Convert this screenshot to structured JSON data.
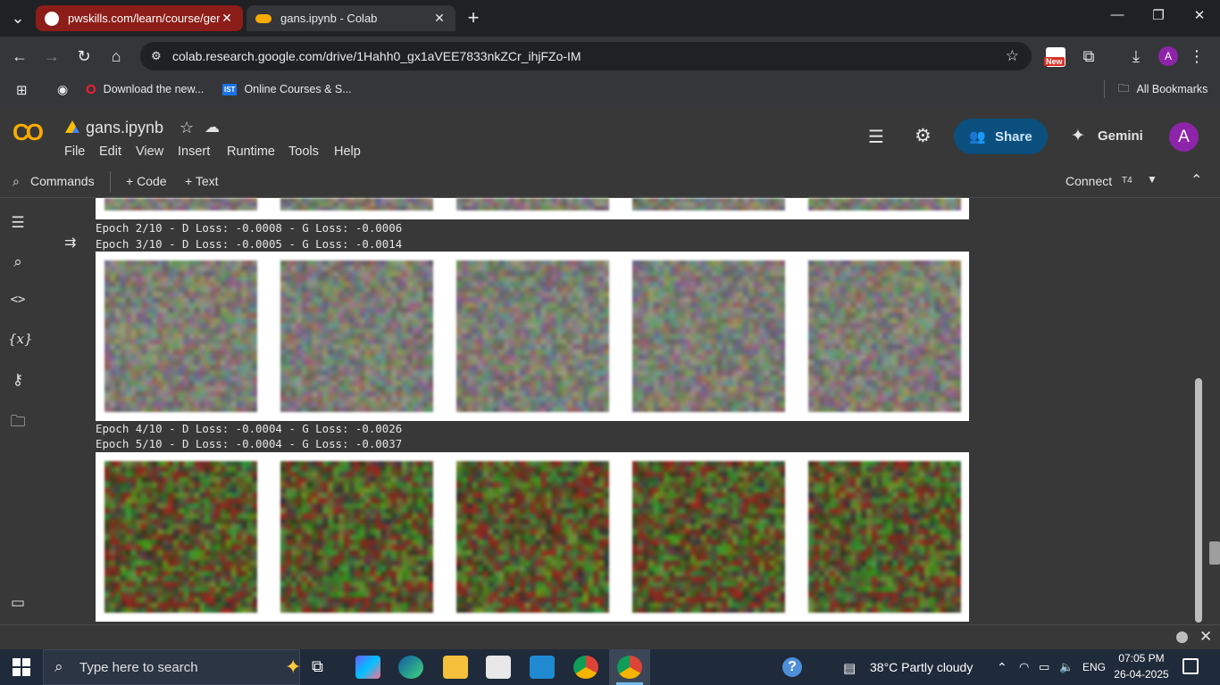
{
  "browser": {
    "tabs": [
      {
        "title": "pwskills.com/learn/course/gena",
        "color": "#8c1d18"
      },
      {
        "title": "gans.ipynb - Colab",
        "active": true
      }
    ],
    "url": "colab.research.google.com/drive/1Hahh0_gx1aVEE7833nkZCr_ihjFZo-IM",
    "ext_badge": "New",
    "profile_initial": "A",
    "bookmarks": [
      "Download the new...",
      "Online Courses & S..."
    ],
    "bookmark_badge": "IST",
    "all_bookmarks": "All Bookmarks"
  },
  "colab": {
    "logo": "CO",
    "notebook_title": "gans.ipynb",
    "menus": [
      "File",
      "Edit",
      "View",
      "Insert",
      "Runtime",
      "Tools",
      "Help"
    ],
    "share_label": "Share",
    "gemini_label": "Gemini",
    "avatar_initial": "A",
    "commands_label": "Commands",
    "code_label": "+ Code",
    "text_label": "+ Text",
    "connect_label": "Connect",
    "runtime_type": "T4"
  },
  "output": {
    "logs": [
      "Epoch 2/10 - D Loss: -0.0008 - G Loss: -0.0006",
      "Epoch 3/10 - D Loss: -0.0005 - G Loss: -0.0014",
      "Epoch 4/10 - D Loss: -0.0004 - G Loss: -0.0026",
      "Epoch 5/10 - D Loss: -0.0004 - G Loss: -0.0037"
    ]
  },
  "taskbar": {
    "search_placeholder": "Type here to search",
    "weather": "38°C  Partly cloudy",
    "language": "ENG",
    "time": "07:05 PM",
    "date": "26-04-2025"
  }
}
